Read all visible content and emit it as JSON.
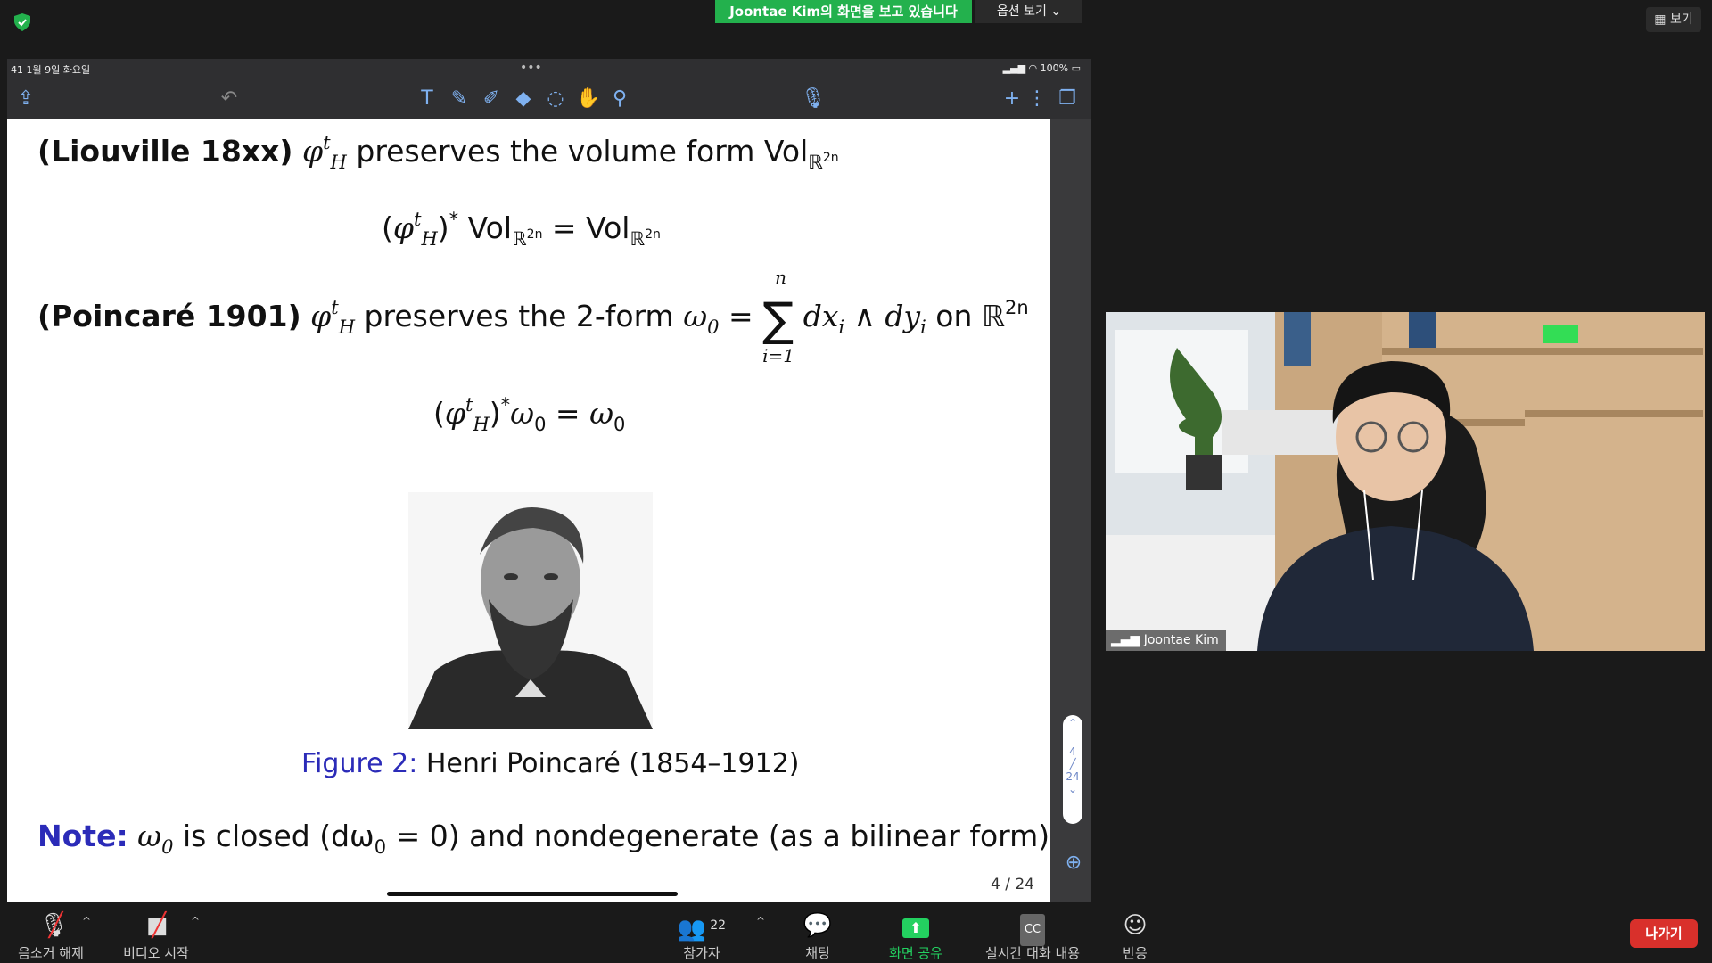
{
  "top": {
    "banner": "Joontae Kim의 화면을 보고 있습니다",
    "options": "옵션 보기 ⌄",
    "view": "보기"
  },
  "ipad_status": {
    "time": "41   1월 9일 화요일",
    "battery": "100%"
  },
  "slide": {
    "liouville_label": "(Liouville 18xx)",
    "liouville_text": "preserves the volume form Vol",
    "poincare_label": "(Poincaré 1901)",
    "poincare_text": "preserves the 2-form",
    "figure_label": "Figure 2:",
    "figure_caption": "Henri Poincaré (1854–1912)",
    "note_label": "Note:",
    "note_text": "is closed (dω",
    "note_text2": " = 0) and nondegenerate (as a bilinear form).",
    "page": "4 / 24",
    "scroll_page": "4",
    "scroll_total": "24"
  },
  "video": {
    "name": "Joontae Kim"
  },
  "controls": {
    "mute": "음소거 해제",
    "video": "비디오 시작",
    "participants": "참가자",
    "participants_count": "22",
    "chat": "채팅",
    "share": "화면 공유",
    "captions": "실시간 대화 내용",
    "reactions": "반응",
    "leave": "나가기"
  }
}
